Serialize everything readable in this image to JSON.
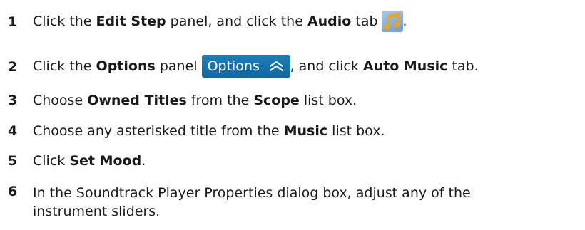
{
  "steps": [
    {
      "number": "1",
      "t1": "Click the ",
      "b1": "Edit Step",
      "t2": " panel, and click the ",
      "b2": "Audio",
      "t3": " tab",
      "t4": "."
    },
    {
      "number": "2",
      "t1": "Click the ",
      "b1": "Options",
      "t2": " panel",
      "button_label": "Options",
      "t3": ", and click ",
      "b2": "Auto Music",
      "t4": " tab."
    },
    {
      "number": "3",
      "t1": "Choose ",
      "b1": "Owned Titles",
      "t2": " from the ",
      "b2": "Scope",
      "t3": " list box."
    },
    {
      "number": "4",
      "t1": "Choose any asterisked title from the ",
      "b1": "Music",
      "t2": " list box."
    },
    {
      "number": "5",
      "t1": "Click ",
      "b1": "Set Mood",
      "t2": "."
    },
    {
      "number": "6",
      "line1": "In the Soundtrack Player Properties dialog box, adjust any of the",
      "line2": "instrument sliders."
    }
  ],
  "icons": {
    "audio_tab": "music-notes-icon",
    "options_chevron": "double-chevron-up-icon"
  },
  "colors": {
    "options_button_bg": "#1470ab",
    "audio_icon_notes": "#f0a21e"
  }
}
